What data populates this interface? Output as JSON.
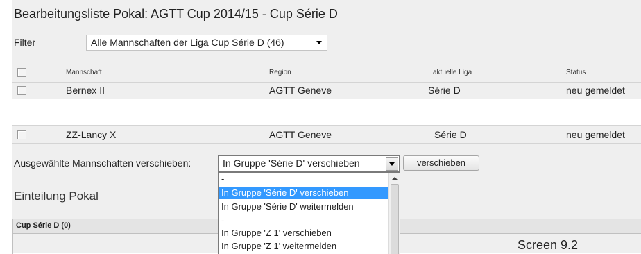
{
  "page": {
    "title": "Bearbeitungsliste Pokal: AGTT Cup 2014/15 - Cup Série D"
  },
  "filter": {
    "label": "Filter",
    "value": "Alle Mannschaften der Liga Cup Série D (46)"
  },
  "table": {
    "headers": [
      "Mannschaft",
      "Region",
      "aktuelle Liga",
      "Status"
    ],
    "rows": [
      {
        "team": "Bernex II",
        "region": "AGTT Geneve",
        "league": "Série D",
        "status": "neu gemeldet"
      },
      {
        "team": "ZZ-Lancy X",
        "region": "AGTT Geneve",
        "league": "Série D",
        "status": "neu gemeldet"
      }
    ]
  },
  "move": {
    "label": "Ausgewählte Mannschaften verschieben:",
    "selected": "In Gruppe 'Série D' verschieben",
    "button": "verschieben",
    "options": [
      "-",
      "In Gruppe 'Série D' verschieben",
      "In Gruppe 'Série D' weitermelden",
      "-",
      "In Gruppe 'Z 1' verschieben",
      "In Gruppe 'Z 1' weitermelden"
    ]
  },
  "section": {
    "title": "Einteilung Pokal",
    "group_header": "Cup Série D (0)"
  },
  "caption": "Screen 9.2",
  "colors": {
    "panel": "#efefef",
    "selection": "#3399ff"
  }
}
